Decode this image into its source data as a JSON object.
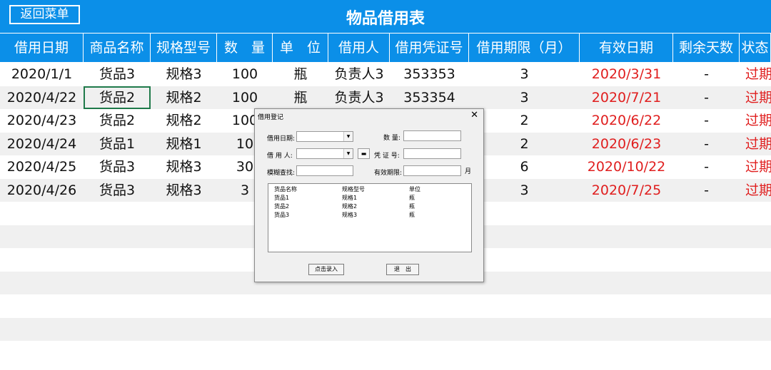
{
  "header": {
    "back_label": "返回菜单",
    "title": "物品借用表"
  },
  "columns": [
    "借用日期",
    "商品名称",
    "规格型号",
    "数　量",
    "单　位",
    "借用人",
    "借用凭证号",
    "借用期限（月）",
    "有效日期",
    "剩余天数",
    "状态"
  ],
  "rows": [
    [
      "2020/1/1",
      "货品3",
      "规格3",
      "100",
      "瓶",
      "负责人3",
      "353353",
      "3",
      "2020/3/31",
      "-",
      "过期"
    ],
    [
      "2020/4/22",
      "货品2",
      "规格2",
      "100",
      "瓶",
      "负责人3",
      "353354",
      "3",
      "2020/7/21",
      "-",
      "过期"
    ],
    [
      "2020/4/23",
      "货品2",
      "规格2",
      "100",
      "",
      "",
      "",
      "2",
      "2020/6/22",
      "-",
      "过期"
    ],
    [
      "2020/4/24",
      "货品1",
      "规格1",
      "10",
      "",
      "",
      "",
      "2",
      "2020/6/23",
      "-",
      "过期"
    ],
    [
      "2020/4/25",
      "货品3",
      "规格3",
      "30",
      "",
      "",
      "",
      "6",
      "2020/10/22",
      "-",
      "过期"
    ],
    [
      "2020/4/26",
      "货品3",
      "规格3",
      "3",
      "",
      "",
      "",
      "3",
      "2020/7/25",
      "-",
      "过期"
    ]
  ],
  "dialog": {
    "title": "借用登记",
    "close": "✕",
    "borrow_date_label": "借用日期:",
    "borrower_label": "借 用 人:",
    "fuzzy_search_label": "模糊查找:",
    "quantity_label": "数  量:",
    "voucher_label": "凭 证 号:",
    "valid_period_label": "有效期限:",
    "month_unit": "月",
    "small_button": "▬",
    "list_header": [
      "货品名称",
      "规格型号",
      "单位"
    ],
    "list_items": [
      [
        "货品1",
        "规格1",
        "瓶"
      ],
      [
        "货品2",
        "规格2",
        "瓶"
      ],
      [
        "货品3",
        "规格3",
        "瓶"
      ]
    ],
    "submit_label": "点击录入",
    "exit_label": "退　出"
  },
  "colors": {
    "accent": "#0b8fe8",
    "expired": "#e01e1e",
    "selection": "#1f7a4a"
  }
}
